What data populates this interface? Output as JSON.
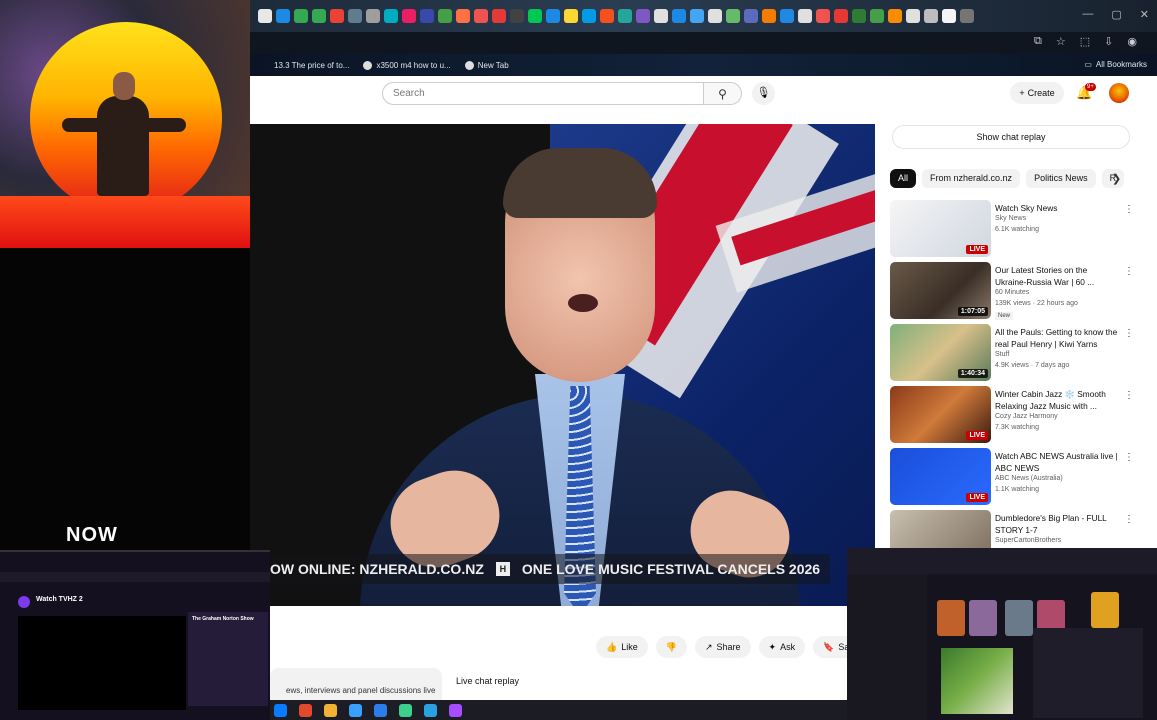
{
  "browser": {
    "tab_favicon_colors": [
      "#e8e8e8",
      "#1e88e5",
      "#34a853",
      "#34a853",
      "#ea4335",
      "#607d8b",
      "#9e9e9e",
      "#00acc1",
      "#e91e63",
      "#3949ab",
      "#43a047",
      "#ff7043",
      "#ef5350",
      "#e53935",
      "#424242",
      "#00c853",
      "#1e88e5",
      "#fdd835",
      "#039be5",
      "#f4511e",
      "#26a69a",
      "#7e57c2",
      "#e0e0e0",
      "#1e88e5",
      "#42a5f5",
      "#e0e0e0",
      "#66bb6a",
      "#5c6bc0",
      "#f57c00",
      "#1e88e5",
      "#e0e0e0",
      "#ef5350",
      "#e53935",
      "#2e7d32",
      "#43a047",
      "#fb8c00",
      "#e0e0e0",
      "#bdbdbd",
      "#f5f5f5",
      "#757575"
    ],
    "bookmarks": [
      {
        "label": "13.3 The price of to..."
      },
      {
        "label": "x3500 m4 how to u..."
      },
      {
        "label": "New Tab"
      }
    ],
    "all_bookmarks_label": "All Bookmarks"
  },
  "youtube": {
    "search_placeholder": "Search",
    "create_label": "Create",
    "notification_count": "9+",
    "video": {
      "ticker_left": "OW ONLINE: NZHERALD.CO.NZ",
      "ticker_right": "ONE LOVE MUSIC FESTIVAL CANCELS 2026",
      "overlay_word": "NOW"
    },
    "actions": [
      {
        "icon": "like-icon",
        "glyph": "👍",
        "label": "Like"
      },
      {
        "icon": "dislike-icon",
        "glyph": "👎",
        "label": ""
      },
      {
        "icon": "share-icon",
        "glyph": "↗",
        "label": "Share"
      },
      {
        "icon": "ask-icon",
        "glyph": "✦",
        "label": "Ask"
      },
      {
        "icon": "save-icon",
        "glyph": "🔖",
        "label": "Save"
      }
    ],
    "description_snippet": "ews, interviews and panel discussions live",
    "live_chat_replay_label": "Live chat replay",
    "show_chat_replay": "Show chat replay",
    "chips": [
      {
        "label": "All",
        "active": true
      },
      {
        "label": "From nzherald.co.nz",
        "active": false
      },
      {
        "label": "Politics News",
        "active": false
      },
      {
        "label": "R",
        "active": false
      }
    ],
    "recommendations": [
      {
        "title": "Watch Sky News",
        "channel": "Sky News",
        "meta": "6.1K watching",
        "badge": "LIVE",
        "thumb": "sky",
        "new": false
      },
      {
        "title": "Our Latest Stories on the Ukraine-Russia War | 60 ...",
        "channel": "60 Minutes",
        "meta": "139K views · 22 hours ago",
        "badge": "1:07:05",
        "thumb": "war",
        "new": true,
        "new_label": "New"
      },
      {
        "title": "All the Pauls: Getting to know the real Paul Henry | Kiwi Yarns",
        "channel": "Stuff",
        "meta": "4.9K views · 7 days ago",
        "badge": "1:40:34",
        "thumb": "paul",
        "new": false
      },
      {
        "title": "Winter Cabin Jazz ❄️ Smooth Relaxing Jazz Music with ...",
        "channel": "Cozy Jazz Harmony",
        "meta": "7.3K watching",
        "badge": "LIVE",
        "thumb": "cabin",
        "new": false
      },
      {
        "title": "Watch ABC NEWS Australia live | ABC NEWS",
        "channel": "ABC News (Australia)",
        "meta": "1.1K watching",
        "badge": "LIVE",
        "thumb": "abc",
        "new": false
      },
      {
        "title": "Dumbledore's Big Plan - FULL STORY 1-7",
        "channel": "SuperCartonBrothers",
        "meta": "",
        "badge": "",
        "thumb": "dumble",
        "new": false
      }
    ]
  },
  "pip_left": {
    "title": "Watch TVHZ 2",
    "side_title": "The Graham Norton Show"
  },
  "taskbar_colors": [
    "#0a7cff",
    "#e34a2c",
    "#f2b233",
    "#3aa0ff",
    "#2b7de9",
    "#3ecf8e",
    "#2aa1e0",
    "#a64dff"
  ]
}
